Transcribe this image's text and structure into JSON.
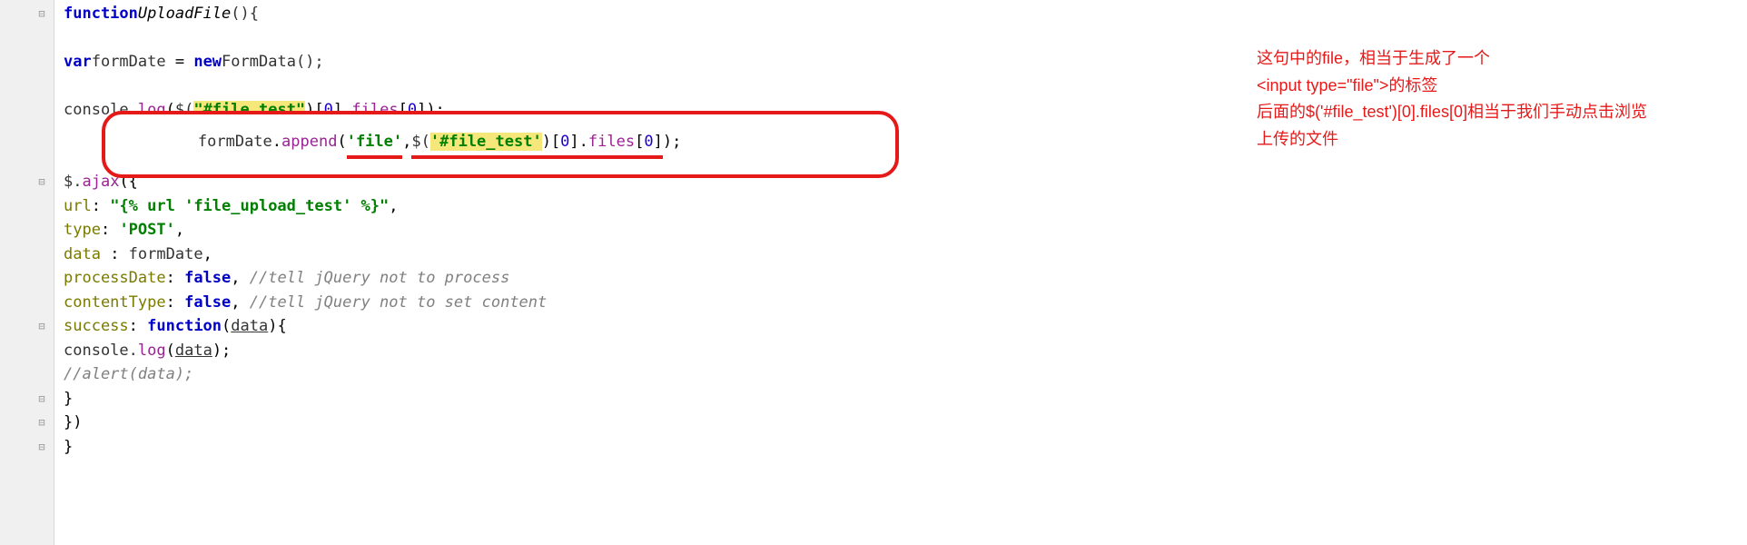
{
  "code": {
    "line1": {
      "kw": "function",
      "fname": "UploadFile",
      "tail": "(){"
    },
    "line2": {
      "kw": "var",
      "varName": "formDate",
      "eq": " = ",
      "newKw": "new",
      "ctor": "FormData",
      "tail": "();"
    },
    "line3": {
      "pre": "console.",
      "method": "log",
      "open": "(",
      "dollar": "$(",
      "str": "\"#file_test\"",
      "close": ")[",
      "idx1": "0",
      "mid": "].",
      "files": "files",
      "open2": "[",
      "idx2": "0",
      "tail": "]);"
    },
    "highlight": {
      "obj": "formDate",
      "dot": ".",
      "method": "append",
      "open": "(",
      "arg1": "'file'",
      "comma": ",",
      "dollar": "$(",
      "sel": "'#file_test'",
      "close1": ")[",
      "idx1": "0",
      "mid": "].",
      "files": "files",
      "open2": "[",
      "idx2": "0",
      "tail": "]);"
    },
    "line5": {
      "dollar": "$.",
      "method": "ajax",
      "tail": "({"
    },
    "line6": {
      "prop": "url",
      "colon": ": ",
      "val": "\"{% url 'file_upload_test' %}\"",
      "tail": ","
    },
    "line7": {
      "prop": "type",
      "colon": ": ",
      "val": "'POST'",
      "tail": ","
    },
    "line8": {
      "prop": "data",
      "colon": " : ",
      "val": "formDate",
      "tail": ","
    },
    "line9": {
      "prop": "processDate",
      "colon": ": ",
      "val": "false",
      "tail": ", ",
      "comment": "//tell jQuery not to process"
    },
    "line10": {
      "prop": "contentType",
      "colon": ": ",
      "val": "false",
      "tail": ", ",
      "comment": "//tell jQuery not to set content"
    },
    "line11": {
      "prop": "success",
      "colon": ": ",
      "kw": "function",
      "open": "(",
      "param": "data",
      "tail": "){"
    },
    "line12": {
      "pre": "console.",
      "method": "log",
      "open": "(",
      "param": "data",
      "tail": ");"
    },
    "line13": {
      "comment": "//alert(data);"
    },
    "line14": {
      "text": "}"
    },
    "line15": {
      "text": "})"
    },
    "line16": {
      "text": "}"
    }
  },
  "annotation": {
    "line1": "这句中的file，相当于生成了一个",
    "line2": "<input type=\"file\">的标签",
    "line3": "后面的$('#file_test')[0].files[0]相当于我们手动点击浏览",
    "line4": "上传的文件"
  }
}
